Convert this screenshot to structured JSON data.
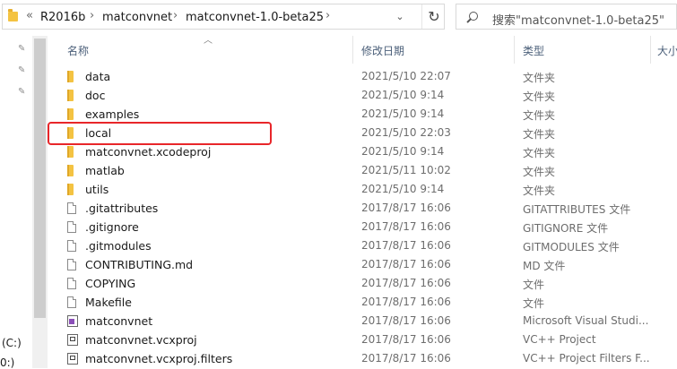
{
  "address": {
    "overflow": "«",
    "crumbs": [
      "R2016b",
      "matconvnet",
      "matconvnet-1.0-beta25"
    ],
    "separator": "›",
    "dropdown": "⌄",
    "refresh": "↻"
  },
  "search": {
    "placeholder": "搜索\"matconvnet-1.0-beta25\""
  },
  "nav": {
    "drive1": "(C:)",
    "drive2": "0:)"
  },
  "columns": {
    "name": "名称",
    "date": "修改日期",
    "type": "类型",
    "size": "大小"
  },
  "files": [
    {
      "name": "data",
      "date": "2021/5/10 22:07",
      "type": "文件夹",
      "icon": "folder"
    },
    {
      "name": "doc",
      "date": "2021/5/10 9:14",
      "type": "文件夹",
      "icon": "folder"
    },
    {
      "name": "examples",
      "date": "2021/5/10 9:14",
      "type": "文件夹",
      "icon": "folder"
    },
    {
      "name": "local",
      "date": "2021/5/10 22:03",
      "type": "文件夹",
      "icon": "folder"
    },
    {
      "name": "matconvnet.xcodeproj",
      "date": "2021/5/10 9:14",
      "type": "文件夹",
      "icon": "folder"
    },
    {
      "name": "matlab",
      "date": "2021/5/11 10:02",
      "type": "文件夹",
      "icon": "folder"
    },
    {
      "name": "utils",
      "date": "2021/5/10 9:14",
      "type": "文件夹",
      "icon": "folder"
    },
    {
      "name": ".gitattributes",
      "date": "2017/8/17 16:06",
      "type": "GITATTRIBUTES 文件",
      "icon": "file"
    },
    {
      "name": ".gitignore",
      "date": "2017/8/17 16:06",
      "type": "GITIGNORE 文件",
      "icon": "file"
    },
    {
      "name": ".gitmodules",
      "date": "2017/8/17 16:06",
      "type": "GITMODULES 文件",
      "icon": "file"
    },
    {
      "name": "CONTRIBUTING.md",
      "date": "2017/8/17 16:06",
      "type": "MD 文件",
      "icon": "file"
    },
    {
      "name": "COPYING",
      "date": "2017/8/17 16:06",
      "type": "文件",
      "icon": "file"
    },
    {
      "name": "Makefile",
      "date": "2017/8/17 16:06",
      "type": "文件",
      "icon": "file"
    },
    {
      "name": "matconvnet",
      "date": "2017/8/17 16:06",
      "type": "Microsoft Visual Studi...",
      "icon": "vs-solution"
    },
    {
      "name": "matconvnet.vcxproj",
      "date": "2017/8/17 16:06",
      "type": "VC++ Project",
      "icon": "project"
    },
    {
      "name": "matconvnet.vcxproj.filters",
      "date": "2017/8/17 16:06",
      "type": "VC++ Project Filters F...",
      "icon": "project"
    }
  ],
  "highlight_color": "#e8262a"
}
